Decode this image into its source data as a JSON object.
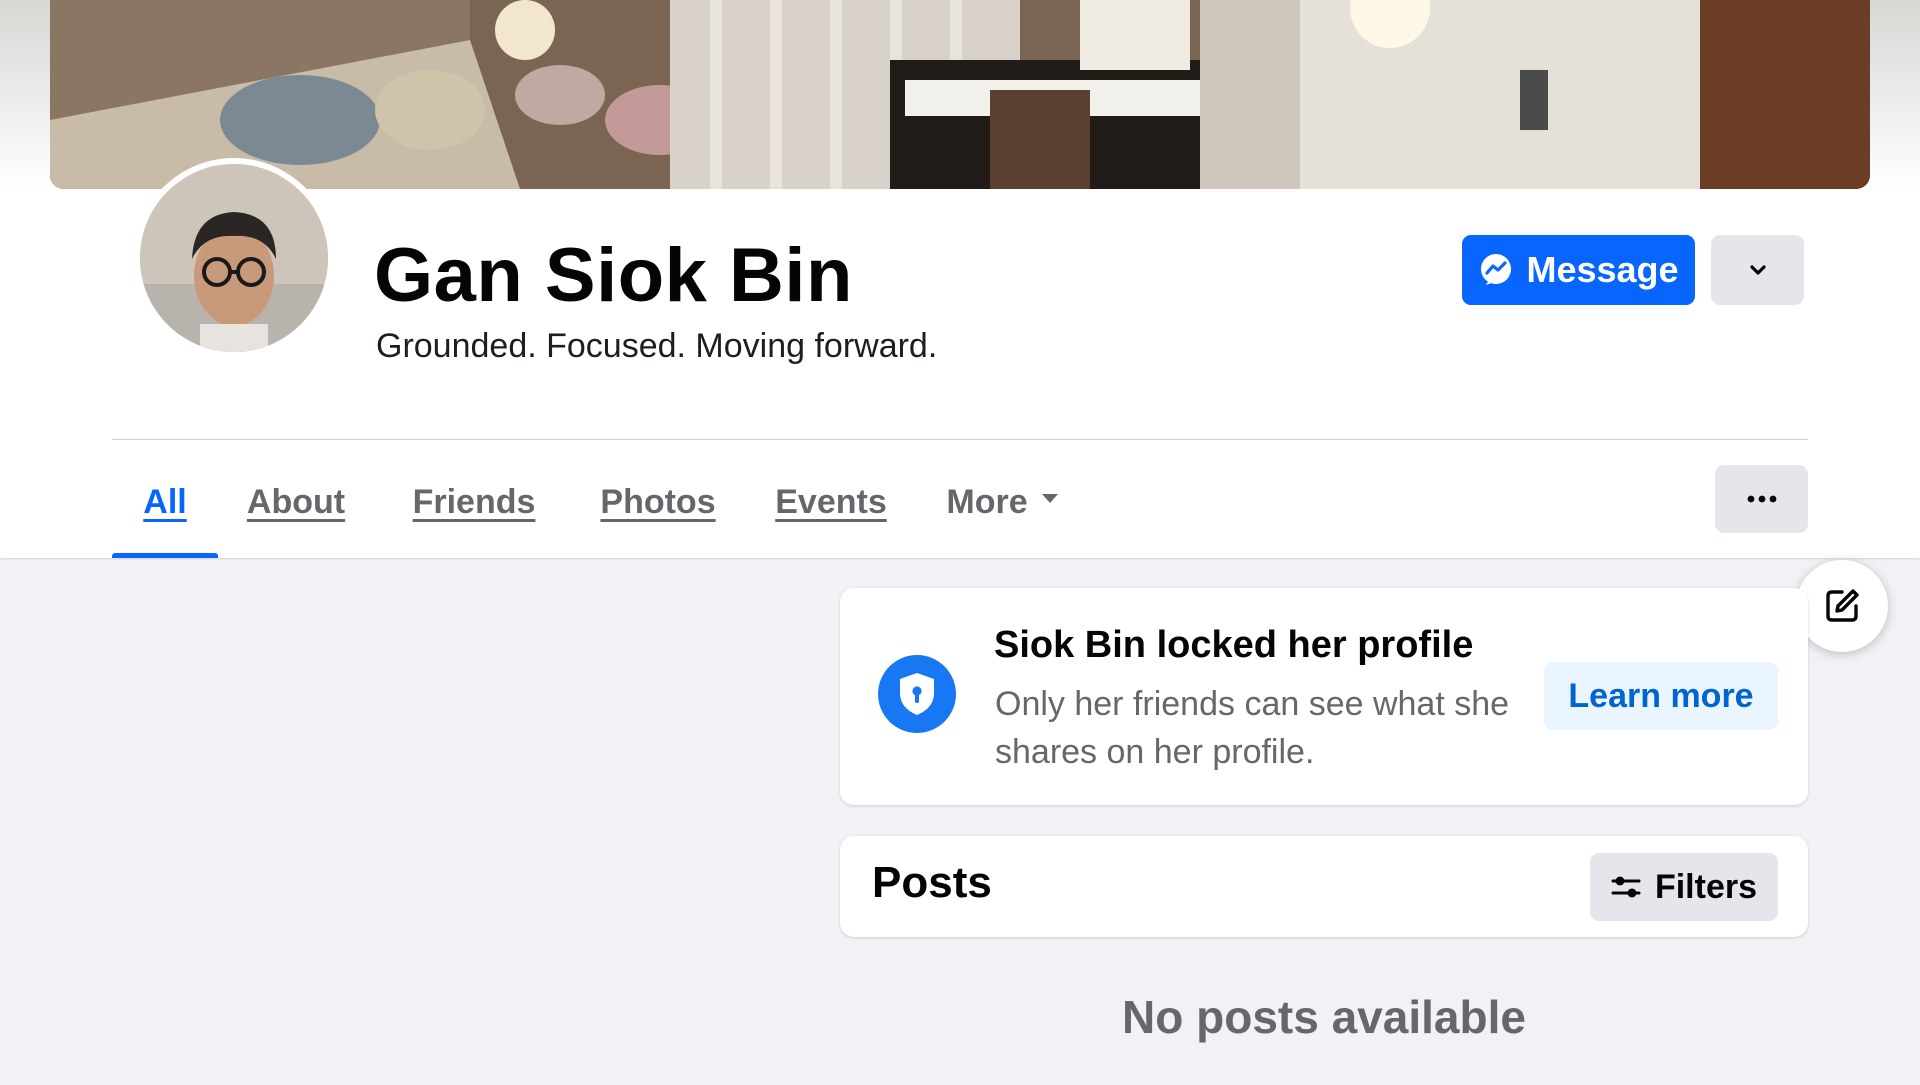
{
  "profile": {
    "name": "Gan Siok Bin",
    "bio": "Grounded. Focused. Moving forward."
  },
  "actions": {
    "message_label": "Message",
    "message_icon": "messenger-icon",
    "dropdown_icon": "chevron-down-icon"
  },
  "tabs": [
    {
      "label": "All",
      "active": true
    },
    {
      "label": "About"
    },
    {
      "label": "Friends"
    },
    {
      "label": "Photos"
    },
    {
      "label": "Events"
    },
    {
      "label": "More"
    }
  ],
  "tabs_more_icon": "ellipsis-icon",
  "edit_icon": "edit-icon",
  "locked_notice": {
    "title": "Siok Bin locked her profile",
    "description": "Only her friends can see what she shares on her profile.",
    "button_label": "Learn more",
    "icon": "shield-lock-icon"
  },
  "posts": {
    "title": "Posts",
    "filters_label": "Filters",
    "filters_icon": "sliders-icon",
    "empty_message": "No posts available"
  },
  "colors": {
    "accent": "#0866ff",
    "secondary_button": "#e4e6eb",
    "page_background": "#f0f2f5",
    "muted_text": "#65676b"
  }
}
